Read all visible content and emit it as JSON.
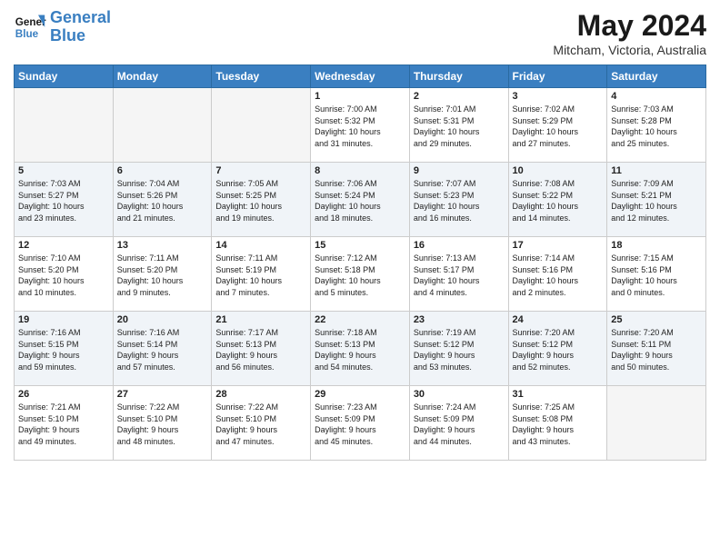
{
  "header": {
    "logo_line1": "General",
    "logo_line2": "Blue",
    "month": "May 2024",
    "location": "Mitcham, Victoria, Australia"
  },
  "weekdays": [
    "Sunday",
    "Monday",
    "Tuesday",
    "Wednesday",
    "Thursday",
    "Friday",
    "Saturday"
  ],
  "weeks": [
    [
      {
        "day": "",
        "info": ""
      },
      {
        "day": "",
        "info": ""
      },
      {
        "day": "",
        "info": ""
      },
      {
        "day": "1",
        "info": "Sunrise: 7:00 AM\nSunset: 5:32 PM\nDaylight: 10 hours\nand 31 minutes."
      },
      {
        "day": "2",
        "info": "Sunrise: 7:01 AM\nSunset: 5:31 PM\nDaylight: 10 hours\nand 29 minutes."
      },
      {
        "day": "3",
        "info": "Sunrise: 7:02 AM\nSunset: 5:29 PM\nDaylight: 10 hours\nand 27 minutes."
      },
      {
        "day": "4",
        "info": "Sunrise: 7:03 AM\nSunset: 5:28 PM\nDaylight: 10 hours\nand 25 minutes."
      }
    ],
    [
      {
        "day": "5",
        "info": "Sunrise: 7:03 AM\nSunset: 5:27 PM\nDaylight: 10 hours\nand 23 minutes."
      },
      {
        "day": "6",
        "info": "Sunrise: 7:04 AM\nSunset: 5:26 PM\nDaylight: 10 hours\nand 21 minutes."
      },
      {
        "day": "7",
        "info": "Sunrise: 7:05 AM\nSunset: 5:25 PM\nDaylight: 10 hours\nand 19 minutes."
      },
      {
        "day": "8",
        "info": "Sunrise: 7:06 AM\nSunset: 5:24 PM\nDaylight: 10 hours\nand 18 minutes."
      },
      {
        "day": "9",
        "info": "Sunrise: 7:07 AM\nSunset: 5:23 PM\nDaylight: 10 hours\nand 16 minutes."
      },
      {
        "day": "10",
        "info": "Sunrise: 7:08 AM\nSunset: 5:22 PM\nDaylight: 10 hours\nand 14 minutes."
      },
      {
        "day": "11",
        "info": "Sunrise: 7:09 AM\nSunset: 5:21 PM\nDaylight: 10 hours\nand 12 minutes."
      }
    ],
    [
      {
        "day": "12",
        "info": "Sunrise: 7:10 AM\nSunset: 5:20 PM\nDaylight: 10 hours\nand 10 minutes."
      },
      {
        "day": "13",
        "info": "Sunrise: 7:11 AM\nSunset: 5:20 PM\nDaylight: 10 hours\nand 9 minutes."
      },
      {
        "day": "14",
        "info": "Sunrise: 7:11 AM\nSunset: 5:19 PM\nDaylight: 10 hours\nand 7 minutes."
      },
      {
        "day": "15",
        "info": "Sunrise: 7:12 AM\nSunset: 5:18 PM\nDaylight: 10 hours\nand 5 minutes."
      },
      {
        "day": "16",
        "info": "Sunrise: 7:13 AM\nSunset: 5:17 PM\nDaylight: 10 hours\nand 4 minutes."
      },
      {
        "day": "17",
        "info": "Sunrise: 7:14 AM\nSunset: 5:16 PM\nDaylight: 10 hours\nand 2 minutes."
      },
      {
        "day": "18",
        "info": "Sunrise: 7:15 AM\nSunset: 5:16 PM\nDaylight: 10 hours\nand 0 minutes."
      }
    ],
    [
      {
        "day": "19",
        "info": "Sunrise: 7:16 AM\nSunset: 5:15 PM\nDaylight: 9 hours\nand 59 minutes."
      },
      {
        "day": "20",
        "info": "Sunrise: 7:16 AM\nSunset: 5:14 PM\nDaylight: 9 hours\nand 57 minutes."
      },
      {
        "day": "21",
        "info": "Sunrise: 7:17 AM\nSunset: 5:13 PM\nDaylight: 9 hours\nand 56 minutes."
      },
      {
        "day": "22",
        "info": "Sunrise: 7:18 AM\nSunset: 5:13 PM\nDaylight: 9 hours\nand 54 minutes."
      },
      {
        "day": "23",
        "info": "Sunrise: 7:19 AM\nSunset: 5:12 PM\nDaylight: 9 hours\nand 53 minutes."
      },
      {
        "day": "24",
        "info": "Sunrise: 7:20 AM\nSunset: 5:12 PM\nDaylight: 9 hours\nand 52 minutes."
      },
      {
        "day": "25",
        "info": "Sunrise: 7:20 AM\nSunset: 5:11 PM\nDaylight: 9 hours\nand 50 minutes."
      }
    ],
    [
      {
        "day": "26",
        "info": "Sunrise: 7:21 AM\nSunset: 5:10 PM\nDaylight: 9 hours\nand 49 minutes."
      },
      {
        "day": "27",
        "info": "Sunrise: 7:22 AM\nSunset: 5:10 PM\nDaylight: 9 hours\nand 48 minutes."
      },
      {
        "day": "28",
        "info": "Sunrise: 7:22 AM\nSunset: 5:10 PM\nDaylight: 9 hours\nand 47 minutes."
      },
      {
        "day": "29",
        "info": "Sunrise: 7:23 AM\nSunset: 5:09 PM\nDaylight: 9 hours\nand 45 minutes."
      },
      {
        "day": "30",
        "info": "Sunrise: 7:24 AM\nSunset: 5:09 PM\nDaylight: 9 hours\nand 44 minutes."
      },
      {
        "day": "31",
        "info": "Sunrise: 7:25 AM\nSunset: 5:08 PM\nDaylight: 9 hours\nand 43 minutes."
      },
      {
        "day": "",
        "info": ""
      }
    ]
  ]
}
